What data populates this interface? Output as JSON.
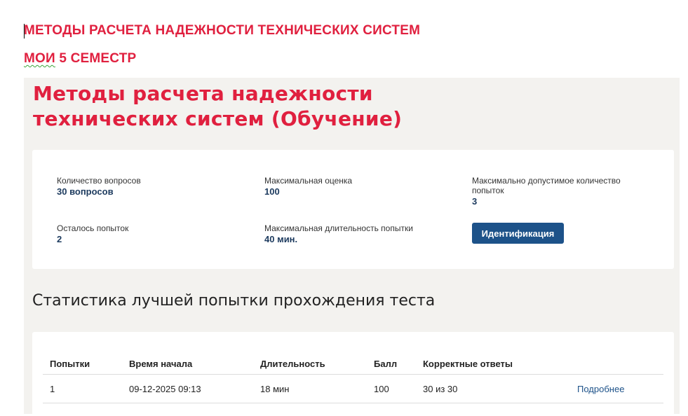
{
  "document": {
    "line1": "МЕТОДЫ РАСЧЕТА НАДЕЖНОСТИ ТЕХНИЧЕСКИХ СИСТЕМ",
    "line2_word": "МОИ",
    "line2_rest": " 5 СЕМЕСТР"
  },
  "course": {
    "title": "Методы расчета надежности технических систем (Обучение)"
  },
  "info": {
    "questions_label": "Количество вопросов",
    "questions_value": "30 вопросов",
    "max_grade_label": "Максимальная оценка",
    "max_grade_value": "100",
    "max_attempts_label": "Максимально допустимое количество попыток",
    "max_attempts_value": "3",
    "remaining_label": "Осталось попыток",
    "remaining_value": "2",
    "duration_label": "Максимальная длительность попытки",
    "duration_value": "40 мин.",
    "identify_button": "Идентификация"
  },
  "stats": {
    "title": "Статистика лучшей попытки прохождения теста",
    "columns": [
      "Попытки",
      "Время начала",
      "Длительность",
      "Балл",
      "Корректные ответы",
      ""
    ],
    "rows": [
      {
        "attempt": "1",
        "start": "09-12-2025 09:13",
        "duration": "18 мин",
        "score": "100",
        "correct": "30 из 30",
        "details": "Подробнее"
      }
    ]
  },
  "colors": {
    "accent_red": "#e0203f",
    "button_blue": "#1d5289",
    "panel_bg": "#f3f2ef"
  }
}
